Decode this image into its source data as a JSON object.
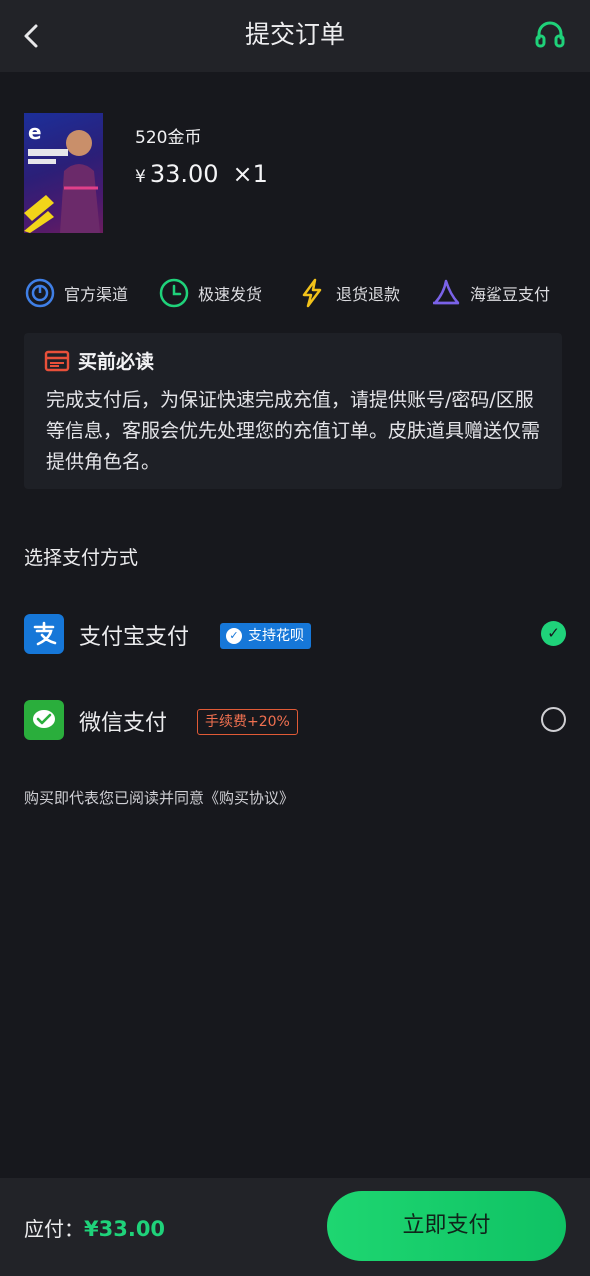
{
  "header": {
    "title": "提交订单",
    "back_icon": "chevron-left-icon",
    "service_icon": "headset-icon"
  },
  "product": {
    "name": "520金币",
    "price_symbol": "¥",
    "price": "33.00",
    "quantity": "×1"
  },
  "badges": [
    {
      "icon": "official-channel-icon",
      "label": "官方渠道"
    },
    {
      "icon": "clock-icon",
      "label": "极速发货"
    },
    {
      "icon": "lightning-icon",
      "label": "退货退款"
    },
    {
      "icon": "shark-fin-icon",
      "label": "海鲨豆支付"
    }
  ],
  "notice": {
    "title": "买前必读",
    "body": "完成支付后，为保证快速完成充值，请提供账号/密码/区服等信息，客服会优先处理您的充值订单。皮肤道具赠送仅需提供角色名。"
  },
  "payment": {
    "section_title": "选择支付方式",
    "methods": [
      {
        "name": "支付宝支付",
        "tag": "支持花呗",
        "selected": true
      },
      {
        "name": "微信支付",
        "tag": "手续费+20%",
        "selected": false
      }
    ]
  },
  "agreement": {
    "text": "购买即代表您已阅读并同意",
    "link": "《购买协议》"
  },
  "footer": {
    "due_label": "应付：",
    "due_amount": "¥33.00",
    "pay_button": "立即支付"
  },
  "colors": {
    "accent": "#1fd27a",
    "background": "#17181d",
    "alipay": "#1677d8",
    "wechat": "#2aae3c",
    "fee_tag": "#e05a36"
  }
}
